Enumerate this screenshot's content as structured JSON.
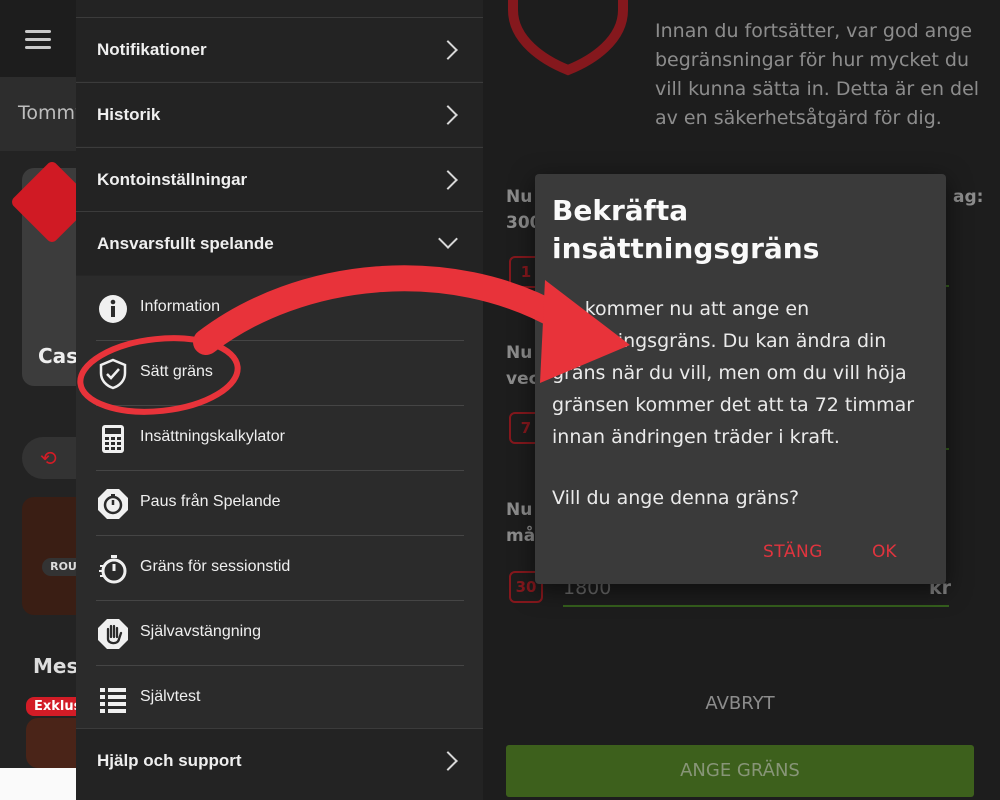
{
  "left_app": {
    "user_name": "Tommy",
    "casino_label": "Cas",
    "roulette_badge": "ROUL",
    "section_title": "Mes",
    "exklusiv_badge": "Exklus"
  },
  "menu": {
    "heads": [
      {
        "label": "Notifikationer"
      },
      {
        "label": "Historik"
      },
      {
        "label": "Kontoinställningar"
      },
      {
        "label": "Ansvarsfullt spelande"
      }
    ],
    "sub_items": [
      {
        "label": "Information",
        "icon": "info-icon"
      },
      {
        "label": "Sätt gräns",
        "icon": "shield-check-icon"
      },
      {
        "label": "Insättningskalkylator",
        "icon": "calculator-icon"
      },
      {
        "label": "Paus från Spelande",
        "icon": "stopwatch-icon"
      },
      {
        "label": "Gräns för sessionstid",
        "icon": "timer-icon"
      },
      {
        "label": "Självavstängning",
        "icon": "hand-stop-icon"
      },
      {
        "label": "Självtest",
        "icon": "list-icon"
      }
    ],
    "footer": {
      "label": "Hjälp och support"
    }
  },
  "right_panel": {
    "intro_text": "Innan du fortsätter, var god ange begränsningar för hur mycket du vill kunna sätta in. Detta är en del av en säkerhetsåtgärd för dig.",
    "limits": [
      {
        "label_left": "Nu",
        "label_left2": "300",
        "label_right": "ag:",
        "icon_text": "1"
      },
      {
        "label_left": "Nu",
        "label_left2": "vec",
        "label_right": "",
        "icon_text": "7"
      },
      {
        "label_left": "Nu",
        "label_left2": "må",
        "label_right": "",
        "icon_text": "30",
        "value": "1800",
        "unit": "kr"
      }
    ],
    "cancel_label": "AVBRYT",
    "set_limit_label": "ANGE GRÄNS"
  },
  "dialog": {
    "title": "Bekräfta insättningsgräns",
    "body": "Du kommer nu att ange en insättningsgräns. Du kan ändra din gräns när du vill, men om du vill höja gränsen kommer det att ta 72 timmar innan ändringen träder i kraft.",
    "question": "Vill du ange denna gräns?",
    "close_label": "STÄNG",
    "ok_label": "OK"
  },
  "colors": {
    "accent_red": "#e0343e",
    "brand_red": "#d21c26",
    "green": "#5a8e2a",
    "annotation_red": "#e8333a"
  }
}
